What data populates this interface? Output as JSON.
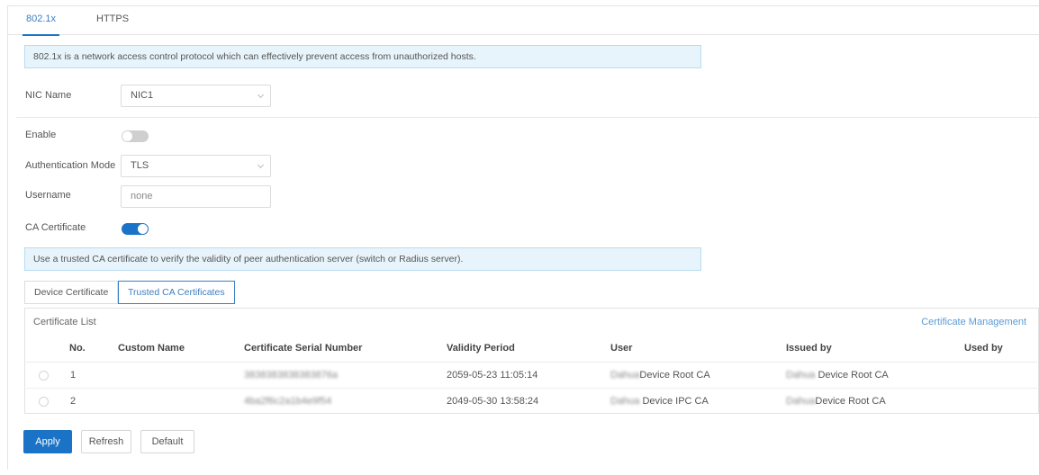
{
  "tabs": [
    {
      "label": "802.1x",
      "active": true
    },
    {
      "label": "HTTPS",
      "active": false
    }
  ],
  "intro": "802.1x is a network access control protocol which can effectively prevent access from unauthorized hosts.",
  "form": {
    "nic_name": {
      "label": "NIC Name",
      "value": "NIC1"
    },
    "enable": {
      "label": "Enable",
      "on": false
    },
    "auth_mode": {
      "label": "Authentication Mode",
      "value": "TLS"
    },
    "username": {
      "label": "Username",
      "value": "none"
    },
    "ca_certificate": {
      "label": "CA Certificate",
      "on": true
    }
  },
  "ca_tip": "Use a trusted CA certificate to verify the validity of peer authentication server (switch or Radius server).",
  "subtabs": [
    {
      "label": "Device Certificate",
      "active": false
    },
    {
      "label": "Trusted CA Certificates",
      "active": true
    }
  ],
  "certificate_list": {
    "title": "Certificate List",
    "management_link": "Certificate Management",
    "columns": [
      "No.",
      "Custom Name",
      "Certificate Serial Number",
      "Validity Period",
      "User",
      "Issued by",
      "Used by"
    ],
    "rows": [
      {
        "no": "1",
        "custom_name": "",
        "serial": "3838383838383876a",
        "validity": "2059-05-23 11:05:14",
        "user_prefix": "Dahua",
        "user": "Device Root CA",
        "issuer_prefix": "Dahua",
        "issuer": " Device Root CA",
        "used_by": ""
      },
      {
        "no": "2",
        "custom_name": "",
        "serial": "4ba2f6c2a1b4e9f54",
        "validity": "2049-05-30 13:58:24",
        "user_prefix": "Dahua",
        "user": " Device IPC CA",
        "issuer_prefix": "Dahua",
        "issuer": "Device Root CA",
        "used_by": ""
      }
    ]
  },
  "buttons": {
    "apply": "Apply",
    "refresh": "Refresh",
    "default": "Default"
  },
  "colors": {
    "accent": "#1a73c6",
    "info_bg": "#e8f4fb",
    "info_border": "#b7dcf1",
    "link": "#5b9bd5"
  }
}
